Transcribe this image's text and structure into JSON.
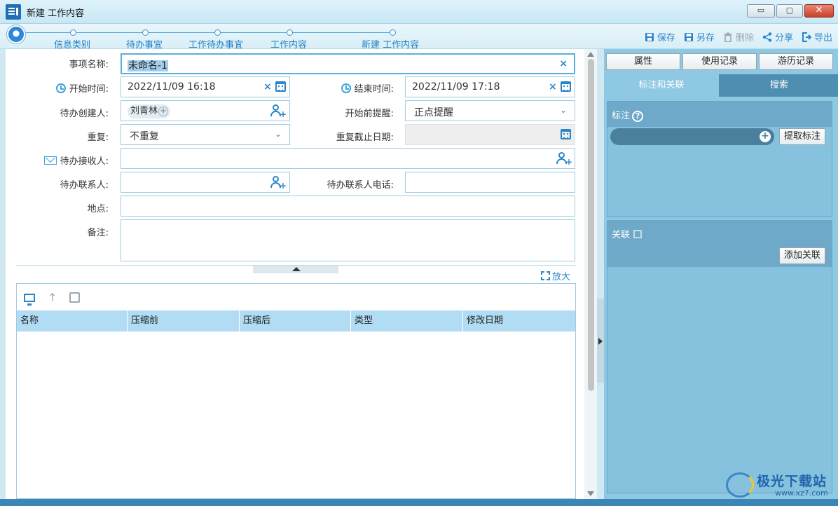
{
  "window": {
    "title": "新建 工作内容",
    "min_glyph": "▭",
    "max_glyph": "▢",
    "close_glyph": "✕"
  },
  "steps": [
    "信息类别",
    "待办事宜",
    "工作待办事宜",
    "工作内容",
    "新建 工作内容"
  ],
  "toolbar": {
    "save": "保存",
    "save_as": "另存",
    "delete": "删除",
    "share": "分享",
    "export": "导出"
  },
  "form": {
    "item_name_label": "事项名称:",
    "item_name_value": "未命名-1",
    "start_time_label": "开始时间:",
    "start_time_value": "2022/11/09 16:18",
    "end_time_label": "结束时间:",
    "end_time_value": "2022/11/09 17:18",
    "creator_label": "待办创建人:",
    "creator_tag": "刘青林",
    "reminder_label": "开始前提醒:",
    "reminder_value": "正点提醒",
    "repeat_label": "重复:",
    "repeat_value": "不重复",
    "repeat_end_label": "重复截止日期:",
    "receiver_label": "待办接收人:",
    "contact_label": "待办联系人:",
    "contact_phone_label": "待办联系人电话:",
    "location_label": "地点:",
    "notes_label": "备注:"
  },
  "attachments": {
    "enlarge": "放大",
    "columns": [
      "名称",
      "压缩前",
      "压缩后",
      "类型",
      "修改日期"
    ]
  },
  "right_panel": {
    "buttons": [
      "属性",
      "使用记录",
      "游历记录"
    ],
    "tabs": [
      "标注和关联",
      "搜索"
    ],
    "annotation_title": "标注",
    "annotation_help": "?",
    "extract_button": "提取标注",
    "relation_title": "关联",
    "add_relation_button": "添加关联"
  },
  "watermark": {
    "brand": "极光下载站",
    "url": "www.xz7.com"
  },
  "colors": {
    "accent": "#2b86c9",
    "panel": "#8fc8e2",
    "tab_bar": "#4e8eb0"
  }
}
